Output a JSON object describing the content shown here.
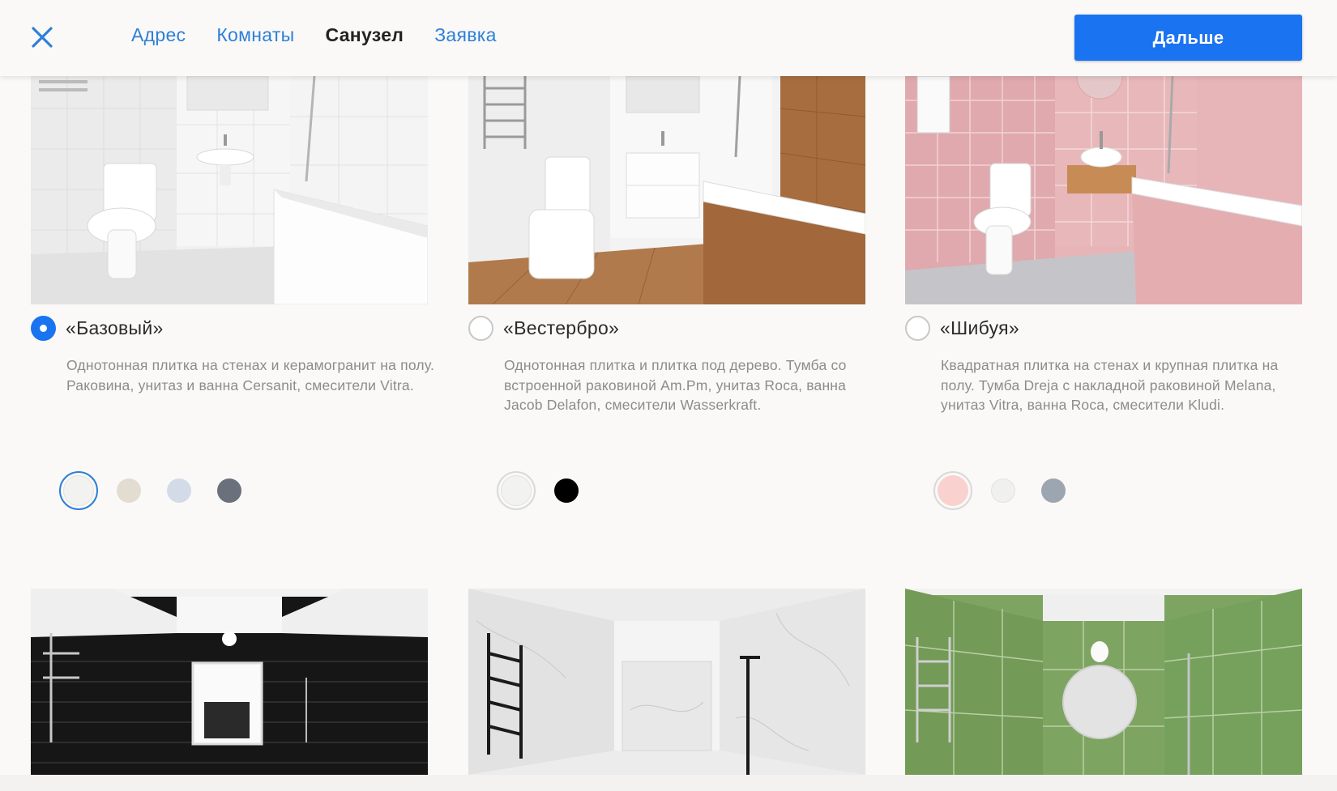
{
  "header": {
    "close_icon": "close-icon",
    "nav": [
      "Адрес",
      "Комнаты",
      "Санузел",
      "Заявка"
    ],
    "active_nav": "Санузел",
    "next_label": "Дальше",
    "accent": "#1a73f0"
  },
  "cards": [
    {
      "title": "«Базовый»",
      "description": "Однотонная плитка на стенах и керамогранит на полу. Раковина, унитаз и ванна Cersanit, смесители Vitra.",
      "selected": true,
      "swatches": [
        "#f2f2f0",
        "#e3dcd0",
        "#d3dbe8",
        "#6a717c"
      ]
    },
    {
      "title": "«Вестербро»",
      "description": "Однотонная плитка и плитка под дерево. Тумба со встроенной раковиной Am.Pm, унитаз Roca, ванна Jacob Delafon, смесители Wasserkraft.",
      "selected": false,
      "swatches": [
        "#f2f2f0",
        "#000000"
      ]
    },
    {
      "title": "«Шибуя»",
      "description": "Квадратная плитка на стенах и крупная плитка на полу. Тумба Dreja с накладной раковиной Melana, унитаз Vitra, ванна Roca, смесители Kludi.",
      "selected": false,
      "swatches": [
        "#f9d1cf",
        "#f0f0ee",
        "#9ca6b0"
      ]
    }
  ],
  "bottom_cards": [
    {
      "image": "black-subway-tile-bathroom"
    },
    {
      "image": "white-marble-bathroom"
    },
    {
      "image": "green-tile-bathroom"
    }
  ]
}
